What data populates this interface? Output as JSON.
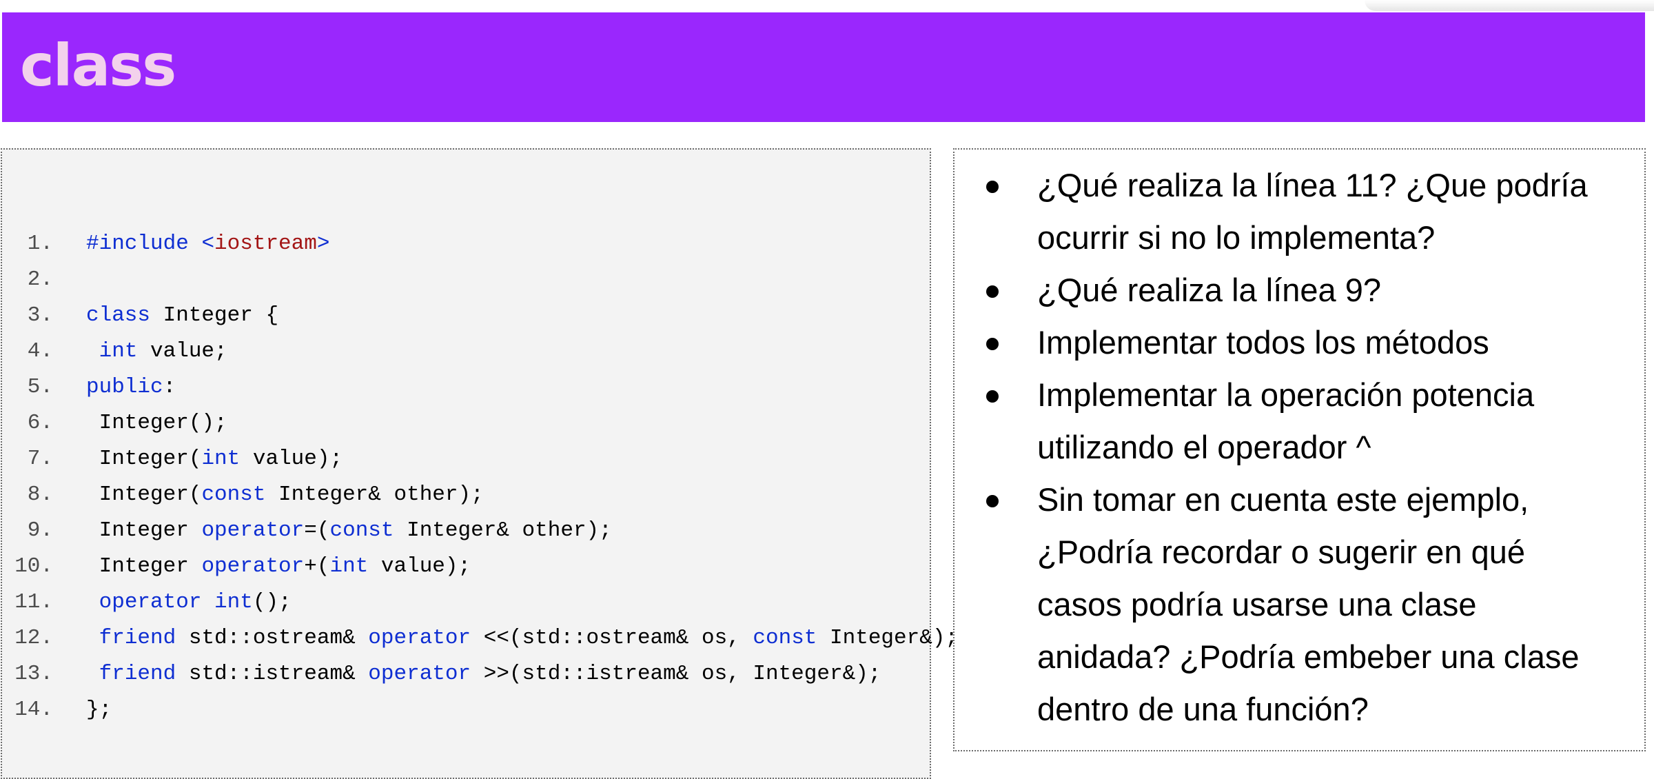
{
  "slide": {
    "title": "class"
  },
  "colors": {
    "title_bar": "#9a27fd",
    "title_text": "#f3d2ec",
    "code_keyword": "#0e2ed2",
    "code_string": "#a31515",
    "code_panel": "#f3f3f3"
  },
  "code": {
    "lines": [
      {
        "num": "1.",
        "parts": [
          {
            "t": "#include ",
            "c": "kw"
          },
          {
            "t": "<",
            "c": "kw"
          },
          {
            "t": "iostream",
            "c": "str"
          },
          {
            "t": ">",
            "c": "kw"
          }
        ]
      },
      {
        "num": "2.",
        "parts": []
      },
      {
        "num": "3.",
        "parts": [
          {
            "t": "class",
            "c": "kw"
          },
          {
            "t": " Integer {",
            "c": ""
          }
        ]
      },
      {
        "num": "4.",
        "parts": [
          {
            "t": " ",
            "c": ""
          },
          {
            "t": "int",
            "c": "kw"
          },
          {
            "t": " value;",
            "c": ""
          }
        ]
      },
      {
        "num": "5.",
        "parts": [
          {
            "t": "public",
            "c": "kw"
          },
          {
            "t": ":",
            "c": ""
          }
        ]
      },
      {
        "num": "6.",
        "parts": [
          {
            "t": " Integer();",
            "c": ""
          }
        ]
      },
      {
        "num": "7.",
        "parts": [
          {
            "t": " Integer(",
            "c": ""
          },
          {
            "t": "int",
            "c": "kw"
          },
          {
            "t": " value);",
            "c": ""
          }
        ]
      },
      {
        "num": "8.",
        "parts": [
          {
            "t": " Integer(",
            "c": ""
          },
          {
            "t": "const",
            "c": "kw"
          },
          {
            "t": " Integer& other);",
            "c": ""
          }
        ]
      },
      {
        "num": "9.",
        "parts": [
          {
            "t": " Integer ",
            "c": ""
          },
          {
            "t": "operator",
            "c": "kw"
          },
          {
            "t": "=(",
            "c": ""
          },
          {
            "t": "const",
            "c": "kw"
          },
          {
            "t": " Integer& other);",
            "c": ""
          }
        ]
      },
      {
        "num": "10.",
        "parts": [
          {
            "t": " Integer ",
            "c": ""
          },
          {
            "t": "operator",
            "c": "kw"
          },
          {
            "t": "+(",
            "c": ""
          },
          {
            "t": "int",
            "c": "kw"
          },
          {
            "t": " value);",
            "c": ""
          }
        ]
      },
      {
        "num": "11.",
        "parts": [
          {
            "t": " ",
            "c": ""
          },
          {
            "t": "operator",
            "c": "kw"
          },
          {
            "t": " ",
            "c": ""
          },
          {
            "t": "int",
            "c": "kw"
          },
          {
            "t": "();",
            "c": ""
          }
        ]
      },
      {
        "num": "12.",
        "parts": [
          {
            "t": " ",
            "c": ""
          },
          {
            "t": "friend",
            "c": "kw"
          },
          {
            "t": " std::ostream& ",
            "c": ""
          },
          {
            "t": "operator",
            "c": "kw"
          },
          {
            "t": " <<(std::ostream& os, ",
            "c": ""
          },
          {
            "t": "const",
            "c": "kw"
          },
          {
            "t": " Integer&);",
            "c": ""
          }
        ]
      },
      {
        "num": "13.",
        "parts": [
          {
            "t": " ",
            "c": ""
          },
          {
            "t": "friend",
            "c": "kw"
          },
          {
            "t": " std::istream& ",
            "c": ""
          },
          {
            "t": "operator",
            "c": "kw"
          },
          {
            "t": " >>(std::istream& os, Integer&);",
            "c": ""
          }
        ]
      },
      {
        "num": "14.",
        "parts": [
          {
            "t": "};",
            "c": ""
          }
        ]
      }
    ]
  },
  "questions": [
    "¿Qué realiza la línea 11? ¿Que podría ocurrir si no lo implementa?",
    "¿Qué realiza la línea 9?",
    "Implementar todos los métodos",
    "Implementar la operación potencia utilizando el operador ^",
    "Sin tomar en cuenta este ejemplo, ¿Podría recordar o sugerir en qué casos podría usarse una clase anidada? ¿Podría embeber una clase dentro de una función?"
  ]
}
